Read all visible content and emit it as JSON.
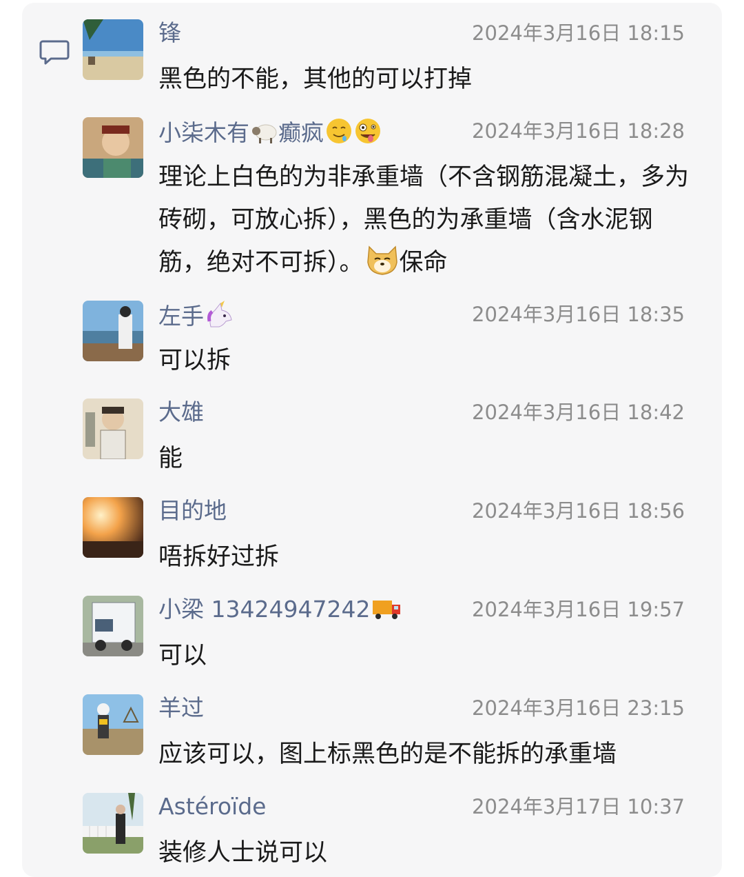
{
  "colors": {
    "panel_bg": "#f6f6f7",
    "name": "#5b6b8c",
    "time": "#8c8c8c",
    "text": "#1a1a1a"
  },
  "comments": [
    {
      "name": "锋",
      "name_emojis": [],
      "time": "2024年3月16日 18:15",
      "text": "黑色的不能，其他的可以打掉"
    },
    {
      "name": "小柒木有",
      "name_emojis": [
        "sheep-emoji",
        "sick-text",
        "drooling-face-emoji",
        "zany-face-emoji"
      ],
      "name_suffix": "癫疯",
      "time": "2024年3月16日 18:28",
      "text": "理论上白色的为非承重墙（不含钢筋混凝土，多为砖砌，可放心拆），黑色的为承重墙（含水泥钢筋，绝对不可拆）。",
      "text_suffix": "保命"
    },
    {
      "name": "左手",
      "name_emojis": [
        "unicorn-emoji"
      ],
      "time": "2024年3月16日 18:35",
      "text": "可以拆"
    },
    {
      "name": "大雄",
      "name_emojis": [],
      "time": "2024年3月16日 18:42",
      "text": "能"
    },
    {
      "name": "目的地",
      "name_emojis": [],
      "time": "2024年3月16日 18:56",
      "text": "唔拆好过拆"
    },
    {
      "name": "小梁 13424947242",
      "name_emojis": [
        "truck-emoji"
      ],
      "time": "2024年3月16日 19:57",
      "text": "可以"
    },
    {
      "name": "羊过",
      "name_emojis": [],
      "time": "2024年3月16日 23:15",
      "text": "应该可以，图上标黑色的是不能拆的承重墙"
    },
    {
      "name": "Astéroïde",
      "name_emojis": [],
      "time": "2024年3月17日 10:37",
      "text": "装修人士说可以"
    }
  ]
}
